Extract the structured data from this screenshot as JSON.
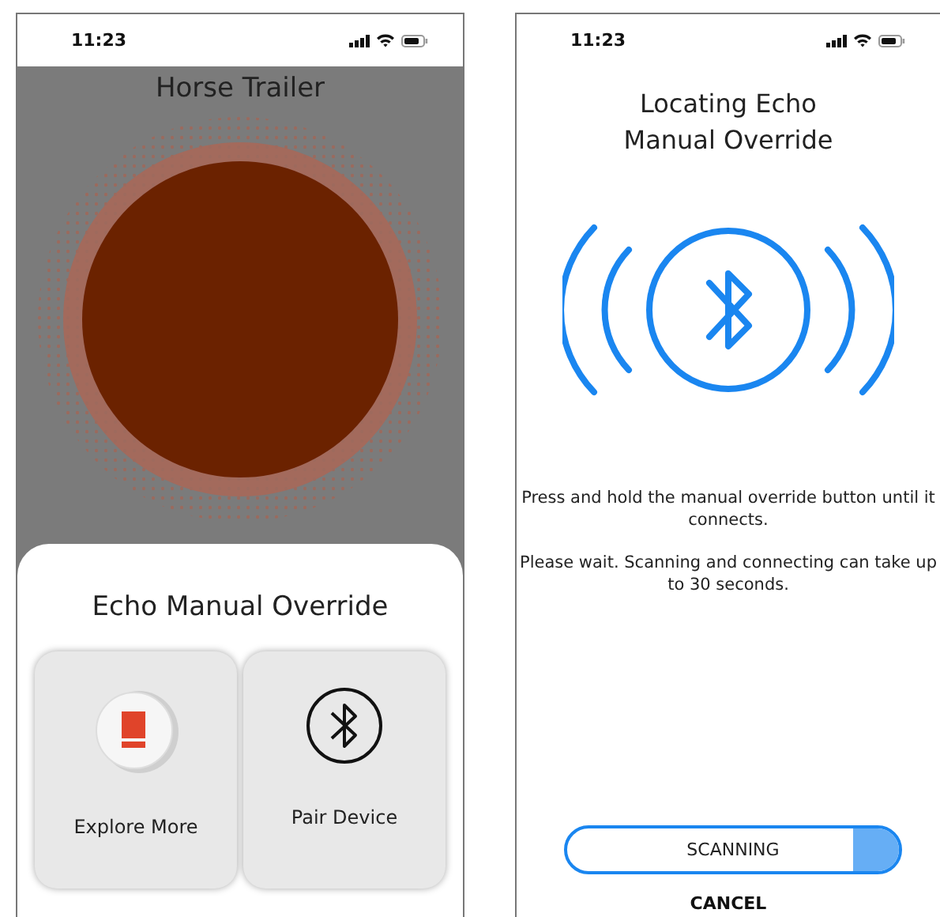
{
  "home_screen": {
    "status_bar": {
      "time": "11:23"
    },
    "title": "Horse Trailer",
    "sheet": {
      "title": "Echo Manual Override",
      "cards": [
        {
          "kind": "device",
          "label": "Explore More"
        },
        {
          "kind": "bluetooth",
          "label": "Pair Device"
        }
      ]
    }
  },
  "locating_screen": {
    "status_bar": {
      "time": "11:23"
    },
    "title_lines": [
      "Locating Echo",
      "Manual Override"
    ],
    "instructions": [
      "Press and hold the manual override button until it connects.",
      "Please wait. Scanning and connecting can take up to 30 seconds."
    ],
    "progress": {
      "label": "SCANNING",
      "level": 0.14
    },
    "cancel": "CANCEL"
  }
}
